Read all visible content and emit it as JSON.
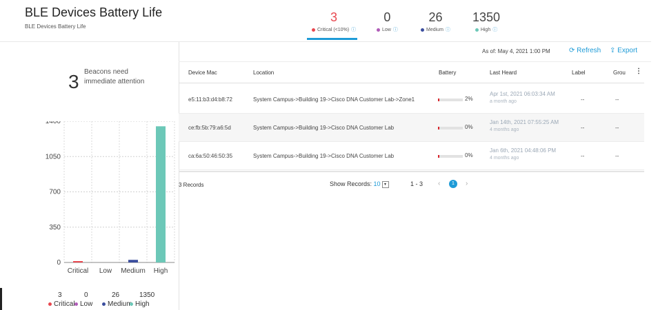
{
  "header": {
    "title": "BLE Devices Battery Life",
    "subtitle": "BLE Devices Battery Life",
    "stats": [
      {
        "value": "3",
        "label": "Critical (<10%)",
        "color": "#e8474f",
        "num_color": "#e8474f"
      },
      {
        "value": "0",
        "label": "Low",
        "color": "#b05cb8",
        "num_color": "#444444"
      },
      {
        "value": "26",
        "label": "Medium",
        "color": "#3b4e9e",
        "num_color": "#444444"
      },
      {
        "value": "1350",
        "label": "High",
        "color": "#6cc8b8",
        "num_color": "#444444"
      }
    ],
    "info_icon": "ⓘ"
  },
  "summary": {
    "count": "3",
    "text": "Beacons need immediate attention"
  },
  "chart_data": {
    "type": "bar",
    "categories": [
      "Critical",
      "Low",
      "Medium",
      "High"
    ],
    "values": [
      3,
      0,
      26,
      1350
    ],
    "colors": [
      "#e8474f",
      "#b05cb8",
      "#3b4e9e",
      "#6cc8b8"
    ],
    "yticks": [
      "0",
      "350",
      "700",
      "1050",
      "1400"
    ],
    "ylim": [
      0,
      1400
    ],
    "grid": true
  },
  "legend": [
    {
      "value": "3",
      "label": "Critical",
      "color": "#e8474f"
    },
    {
      "value": "0",
      "label": "Low",
      "color": "#b05cb8"
    },
    {
      "value": "26",
      "label": "Medium",
      "color": "#3b4e9e"
    },
    {
      "value": "1350",
      "label": "High",
      "color": "#6cc8b8"
    }
  ],
  "toolbar": {
    "as_of": "As of: May 4, 2021 1:00 PM",
    "refresh_label": "Refresh",
    "export_label": "Export",
    "refresh_icon": "⟳",
    "export_icon": "⇪"
  },
  "table": {
    "columns": [
      "Device Mac",
      "Location",
      "Battery",
      "Last Heard",
      "Label",
      "Grou"
    ],
    "menu_icon": "⋮",
    "rows": [
      {
        "mac": "e5:11:b3:d4:b8:72",
        "location": "System Campus->Building 19->Cisco DNA Customer Lab->Zone1",
        "battery": "2%",
        "battery_level": 0.02,
        "heard": "Apr 1st, 2021 06:03:34 AM",
        "heard_ago": "a month ago",
        "label": "--",
        "group": "--"
      },
      {
        "mac": "ce:fb:5b:79:a6:5d",
        "location": "System Campus->Building 19->Cisco DNA Customer Lab",
        "battery": "0%",
        "battery_level": 0.0,
        "heard": "Jan 14th, 2021 07:55:25 AM",
        "heard_ago": "4 months ago",
        "label": "--",
        "group": "--"
      },
      {
        "mac": "ca:6a:50:46:50:35",
        "location": "System Campus->Building 19->Cisco DNA Customer Lab",
        "battery": "0%",
        "battery_level": 0.0,
        "heard": "Jan 6th, 2021 04:48:06 PM",
        "heard_ago": "4 months ago",
        "label": "--",
        "group": "--"
      }
    ]
  },
  "pagination": {
    "records": "3 Records",
    "show_label": "Show Records:",
    "page_size": "10",
    "range": "1 - 3",
    "current_page": "1",
    "prev_icon": "‹",
    "next_icon": "›",
    "dropdown_icon": "▾"
  }
}
